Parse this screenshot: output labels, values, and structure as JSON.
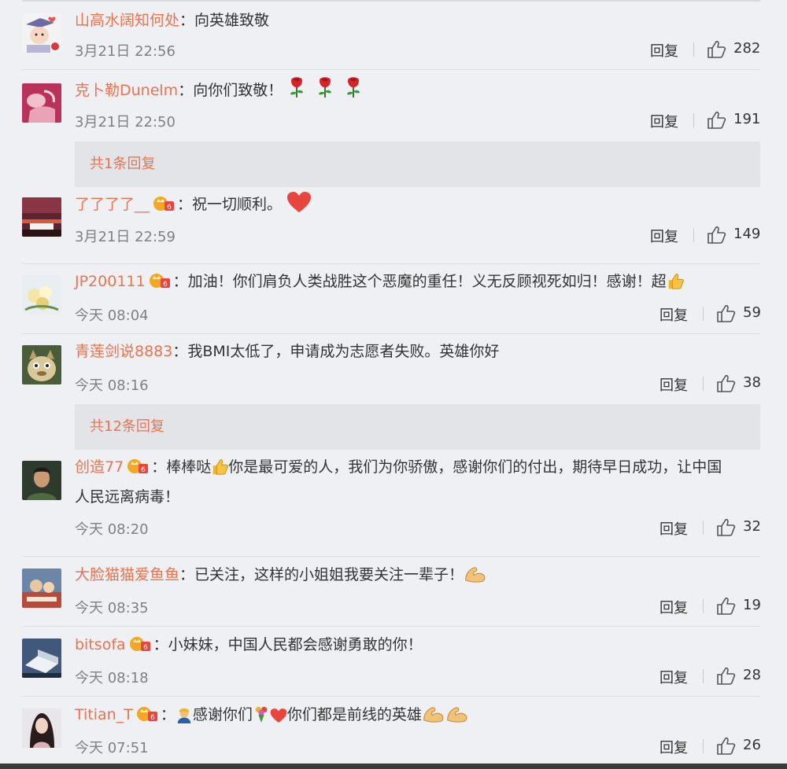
{
  "comments": [
    {
      "user": "山高水阔知何处",
      "vip": false,
      "text": "向英雄致敬",
      "time": "3月21日 22:56",
      "reply": "回复",
      "likes": "282"
    },
    {
      "user": "克卜勒Dunelm",
      "vip": false,
      "text": "向你们致敬！",
      "time": "3月21日 22:50",
      "reply": "回复",
      "likes": "191",
      "emoji": "rose-emoji x3"
    },
    {
      "user": "了了了了__",
      "vip": true,
      "text": "祝一切顺利。",
      "time": "3月21日 22:59",
      "reply": "回复",
      "likes": "149",
      "emoji": "heart-emoji"
    },
    {
      "user": "JP200111",
      "vip": true,
      "text": "加油！你们肩负人类战胜这个恶魔的重任！义无反顾视死如归！感谢！超",
      "time": "今天 08:04",
      "reply": "回复",
      "likes": "59",
      "emoji": "thumbs-up-emoji"
    },
    {
      "user": "青莲剑说8883",
      "vip": true,
      "text": "我BMI太低了，申请成为志愿者失败。英雄你好",
      "time": "今天 08:16",
      "reply": "回复",
      "likes": "38"
    },
    {
      "user": "创造77",
      "vip": true,
      "text_a": "棒棒哒",
      "text_b": "你是最可爱的人，我们为你骄傲，感谢你们的付出，期待早日成功，让中国",
      "text_c": "人民远离病毒！",
      "time": "今天 08:20",
      "reply": "回复",
      "likes": "32",
      "emoji": "thumbs-up-emoji"
    },
    {
      "user": "大脸猫猫爱鱼鱼",
      "vip": false,
      "text": "已关注，这样的小姐姐我要关注一辈子！",
      "time": "今天 08:35",
      "reply": "回复",
      "likes": "19",
      "emoji": "muscle-emoji"
    },
    {
      "user": "bitsofa",
      "vip": true,
      "text": "小妹妹，中国人民都会感谢勇敢的你！",
      "time": "今天 08:18",
      "reply": "回复",
      "likes": "28"
    },
    {
      "user": "Titian_T",
      "vip": true,
      "text_a": "感谢你们",
      "text_b": "你们都是前线的英雄",
      "time": "今天 07:51",
      "reply": "回复",
      "likes": "26",
      "emoji": "worker, bouquet, heart, muscle x2"
    }
  ],
  "sub_replies": [
    "共1条回复",
    "共12条回复"
  ],
  "colon": "：",
  "colors": {
    "username": "#eb7350",
    "background": "#eef0f3",
    "subreply_bg": "#e2e4e8",
    "vip_badge": "#f5a623",
    "heart": "#e8453c"
  }
}
